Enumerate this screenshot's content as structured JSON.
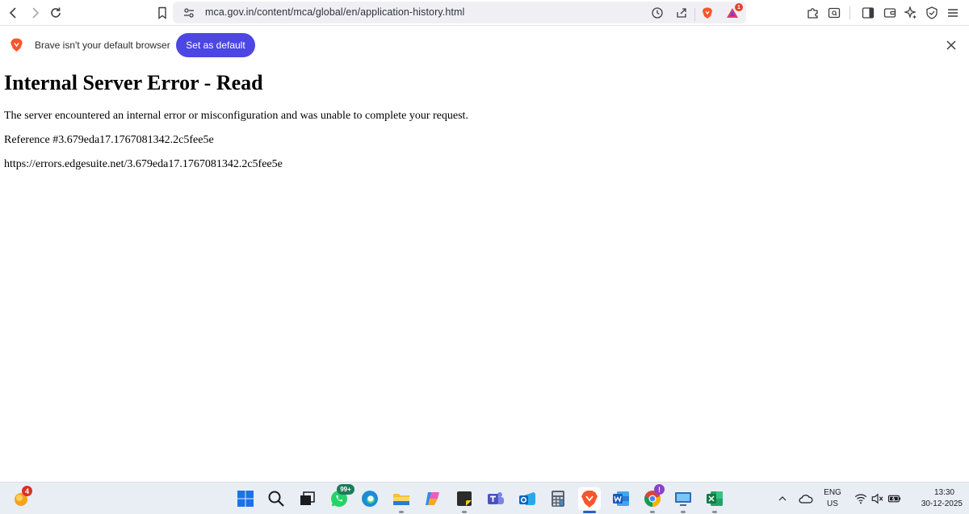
{
  "browser": {
    "url": "mca.gov.in/content/mca/global/en/application-history.html",
    "rewards_badge": "1"
  },
  "infobar": {
    "message": "Brave isn't your default browser",
    "set_default_label": "Set as default"
  },
  "page": {
    "title": "Internal Server Error - Read",
    "description": "The server encountered an internal error or misconfiguration and was unable to complete your request.",
    "reference": "Reference #3.679eda17.1767081342.2c5fee5e",
    "error_url": "https://errors.edgesuite.net/3.679eda17.1767081342.2c5fee5e"
  },
  "taskbar": {
    "widget_badge": "4",
    "whatsapp_badge": "99+",
    "chrome_badge": "!",
    "language_line1": "ENG",
    "language_line2": "US",
    "time": "13:30",
    "date": "30-12-2025"
  },
  "colors": {
    "accent": "#4c47e3",
    "brave_orange": "#fb542b",
    "taskbar_bg": "#e9eef5"
  }
}
